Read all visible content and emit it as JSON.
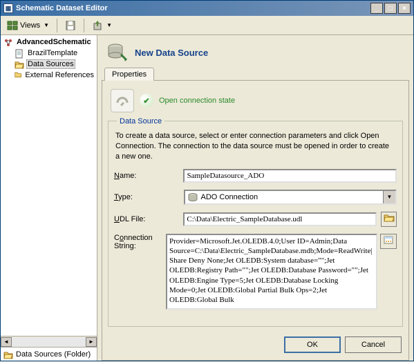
{
  "window": {
    "title": "Schematic Dataset Editor"
  },
  "toolbar": {
    "views_label": "Views"
  },
  "tree": {
    "root": "AdvancedSchematic",
    "items": [
      {
        "label": "BrazilTemplate"
      },
      {
        "label": "Data Sources"
      },
      {
        "label": "External References"
      }
    ]
  },
  "status": {
    "text": "Data Sources (Folder)"
  },
  "header": {
    "title": "New Data Source"
  },
  "tabs": {
    "properties": "Properties"
  },
  "conn": {
    "state": "Open connection state"
  },
  "datasource": {
    "legend": "Data Source",
    "help": "To create a data source, select or enter connection parameters and click Open Connection.  The connection to the data source must be opened in order to create a new one.",
    "name_label": "Name:",
    "name_value": "SampleDatasource_ADO",
    "type_label": "Type:",
    "type_value": "ADO Connection",
    "udl_label": "UDL File:",
    "udl_value": "C:\\Data\\Electric_SampleDatabase.udl",
    "connstr_label": "Connection String:",
    "connstr_value": "Provider=Microsoft.Jet.OLEDB.4.0;User ID=Admin;Data Source=C:\\Data\\Electric_SampleDatabase.mdb;Mode=ReadWrite|Share Deny None;Jet OLEDB:System database=\"\";Jet OLEDB:Registry Path=\"\";Jet OLEDB:Database Password=\"\";Jet OLEDB:Engine Type=5;Jet OLEDB:Database Locking Mode=0;Jet OLEDB:Global Partial Bulk Ops=2;Jet OLEDB:Global Bulk"
  },
  "buttons": {
    "ok": "OK",
    "cancel": "Cancel"
  }
}
